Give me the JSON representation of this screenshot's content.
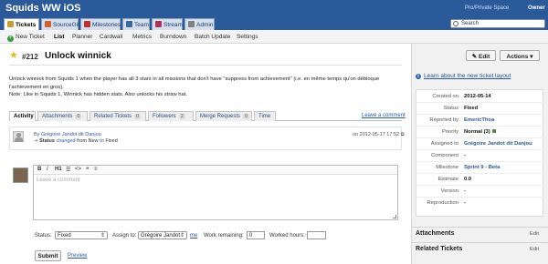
{
  "app": {
    "title": "Squids WW iOS",
    "space": "Pro/Private Space",
    "role": "Owner"
  },
  "tabs": [
    {
      "label": "Tickets",
      "color": "#c8a030"
    },
    {
      "label": "SourceGit",
      "color": "#d06030"
    },
    {
      "label": "Milestones",
      "color": "#c03030"
    },
    {
      "label": "Team",
      "color": "#3a6aa0"
    },
    {
      "label": "Stream",
      "color": "#b0305a"
    },
    {
      "label": "Admin",
      "color": "#808080"
    }
  ],
  "search": {
    "value": "Search"
  },
  "subnav": [
    "New Ticket",
    "List",
    "Planner",
    "Cardwall",
    "Metrics",
    "Burndown",
    "Batch Update",
    "Settings"
  ],
  "ticket": {
    "number": "#212",
    "title": "Unlock winnick",
    "description": [
      "Unlock winnick from Squids 1 when the player has all 3 stars in all missions that don't have \"suppress from achievement\" (i.e. en même temps qu'on débloque",
      "l'achievement en gros).",
      "Note: Like in Squids 1, Winnick has hidden stats. Also unlocks his straw hat."
    ]
  },
  "detail_tabs": [
    {
      "label": "Activity",
      "count": ""
    },
    {
      "label": "Attachments",
      "count": "0"
    },
    {
      "label": "Related Tickets",
      "count": "0"
    },
    {
      "label": "Followers",
      "count": "2"
    },
    {
      "label": "Merge Requests",
      "count": "0"
    },
    {
      "label": "Time",
      "count": ""
    }
  ],
  "leave_comment": "Leave a comment",
  "change": {
    "by_prefix": "By",
    "author": "Grégoire Jandot dit Danjou",
    "date": "on 2012-05-17 17:52",
    "field": "Status",
    "verb": "changed",
    "from_word": "from",
    "old": "New",
    "to_word": "to",
    "new": "Fixed"
  },
  "editor": {
    "toolbar": [
      "B",
      "I",
      "H1",
      "☰",
      "<>",
      "❝",
      "≡"
    ],
    "placeholder": "Leave a comment"
  },
  "form": {
    "status_label": "Status:",
    "status_value": "Fixed",
    "assign_label": "Assign to:",
    "assign_value": "Grégoire Jandot",
    "me": "me",
    "remaining_label": "Work remaining:",
    "remaining_value": "0",
    "worked_label": "Worked hours:",
    "worked_value": "",
    "submit": "Submit",
    "preview": "Preview"
  },
  "side": {
    "edit": "Edit",
    "actions": "Actions",
    "learn": "Learn about the new ticket layout",
    "properties": [
      {
        "key": "Created on",
        "value": "2012-05-14"
      },
      {
        "key": "Status",
        "value": "Fixed"
      },
      {
        "key": "Reported by",
        "value": "EmericThoa"
      },
      {
        "key": "Priority",
        "value": "Normal (3)"
      },
      {
        "key": "Assigned to",
        "value": "Grégoire Jandot dit Danjou"
      },
      {
        "key": "Component",
        "value": "-"
      },
      {
        "key": "Milestone",
        "value": "Sprint 9 - Beta"
      },
      {
        "key": "Estimate",
        "value": "0.0"
      },
      {
        "key": "Version",
        "value": "-"
      },
      {
        "key": "Reproduction",
        "value": "-"
      }
    ],
    "attachments": "Attachments",
    "related": "Related Tickets",
    "edit_link": "Edit"
  },
  "colors": {
    "header": "#2a5a9a",
    "link": "#2a5a9a",
    "priority": "#4a8a3a"
  }
}
